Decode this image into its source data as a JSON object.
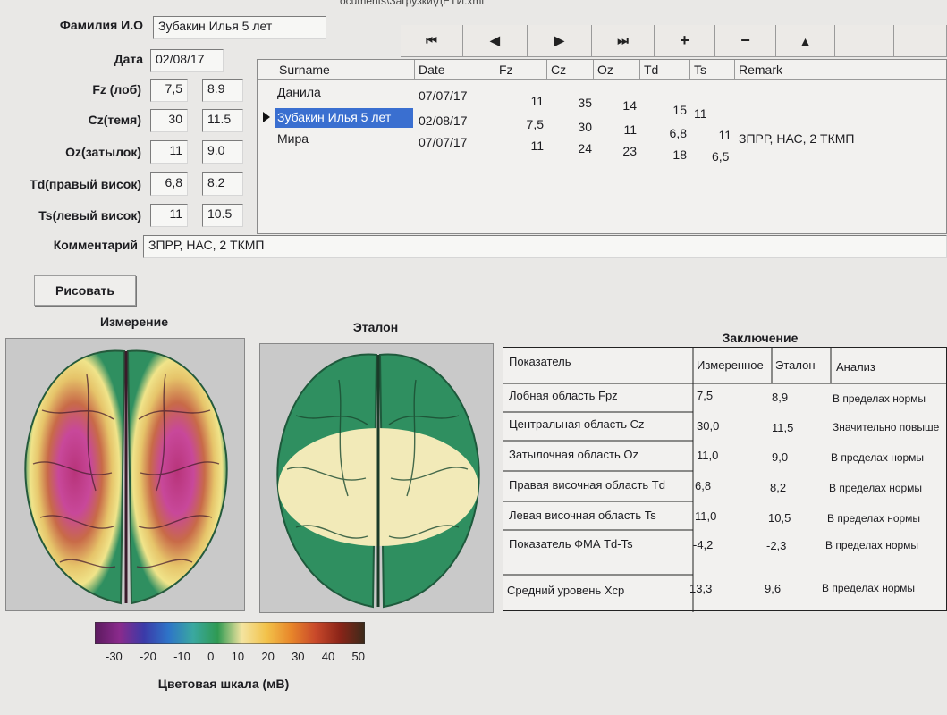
{
  "window": {
    "title_partial": "ocuments\\Загрузки\\ДЕТИ.xml"
  },
  "form": {
    "name_label": "Фамилия И.О",
    "name_value": "Зубакин Илья 5 лет",
    "date_label": "Дата",
    "date_value": "02/08/17",
    "rows": [
      {
        "label": "Fz (лоб)",
        "measured": "7,5",
        "reference": "8.9"
      },
      {
        "label": "Cz(темя)",
        "measured": "30",
        "reference": "11.5"
      },
      {
        "label": "Oz(затылок)",
        "measured": "11",
        "reference": "9.0"
      },
      {
        "label": "Td(правый висок)",
        "measured": "6,8",
        "reference": "8.2"
      },
      {
        "label": "Ts(левый висок)",
        "measured": "11",
        "reference": "10.5"
      }
    ],
    "comment_label": "Комментарий",
    "comment_value": "ЗПРР, НАС, 2 ТКМП",
    "draw_button": "Рисовать"
  },
  "navigator": {
    "buttons": [
      {
        "icon": "first-record-icon",
        "glyph": "⏮"
      },
      {
        "icon": "prev-record-icon",
        "glyph": "◀"
      },
      {
        "icon": "next-record-icon",
        "glyph": "▶"
      },
      {
        "icon": "last-record-icon",
        "glyph": "⏭"
      },
      {
        "icon": "add-record-icon",
        "glyph": "+"
      },
      {
        "icon": "delete-record-icon",
        "glyph": "−"
      },
      {
        "icon": "edit-record-icon",
        "glyph": "▲"
      },
      {
        "icon": "post-record-icon",
        "glyph": ""
      },
      {
        "icon": "cancel-record-icon",
        "glyph": ""
      }
    ]
  },
  "grid": {
    "columns": [
      "Surname",
      "Date",
      "Fz",
      "Cz",
      "Oz",
      "Td",
      "Ts",
      "Remark"
    ],
    "rows": [
      {
        "surname": "Данила",
        "date": "07/07/17",
        "fz": "11",
        "cz": "35",
        "oz": "14",
        "td": "15",
        "ts": "11",
        "remark": ""
      },
      {
        "surname": "Зубакин Илья 5 лет",
        "date": "02/08/17",
        "fz": "7,5",
        "cz": "30",
        "oz": "11",
        "td": "6,8",
        "ts": "11",
        "remark": "ЗПРР, НАС, 2 ТКМП"
      },
      {
        "surname": "Мира",
        "date": "07/07/17",
        "fz": "11",
        "cz": "24",
        "oz": "23",
        "td": "18",
        "ts": "6,5",
        "remark": ""
      }
    ],
    "selected_index": 1
  },
  "maps": {
    "measured_title": "Измерение",
    "reference_title": "Эталон"
  },
  "scale": {
    "ticks": [
      "-30",
      "-20",
      "-10",
      "0",
      "10",
      "20",
      "30",
      "40",
      "50"
    ],
    "caption": "Цветовая шкала (мВ)",
    "colors": [
      "#5b1a5e",
      "#8a2a8c",
      "#3b3aa8",
      "#2e74c8",
      "#3aa8a0",
      "#2f9a52",
      "#f4e4a0",
      "#f2c24a",
      "#e8862a",
      "#c8482a",
      "#8a2418",
      "#3a2a1a"
    ]
  },
  "conclusion": {
    "title": "Заключение",
    "headers": [
      "Показатель",
      "Измеренное",
      "Эталон",
      "Анализ"
    ],
    "rows": [
      {
        "name": "Лобная область Fpz",
        "measured": "7,5",
        "reference": "8,9",
        "analysis": "В пределах нормы"
      },
      {
        "name": "Центральная область Cz",
        "measured": "30,0",
        "reference": "11,5",
        "analysis": "Значительно повыше"
      },
      {
        "name": "Затылочная область Oz",
        "measured": "11,0",
        "reference": "9,0",
        "analysis": "В пределах нормы"
      },
      {
        "name": "Правая височная область Td",
        "measured": "6,8",
        "reference": "8,2",
        "analysis": "В пределах нормы"
      },
      {
        "name": "Левая височная область Ts",
        "measured": "11,0",
        "reference": "10,5",
        "analysis": "В пределах нормы"
      },
      {
        "name": "Показатель ФМА Td-Ts",
        "measured": "-4,2",
        "reference": "-2,3",
        "analysis": "В пределах нормы"
      },
      {
        "name": "Средний уровень Хср",
        "measured": "13,3",
        "reference": "9,6",
        "analysis": "В пределах нормы"
      }
    ]
  }
}
